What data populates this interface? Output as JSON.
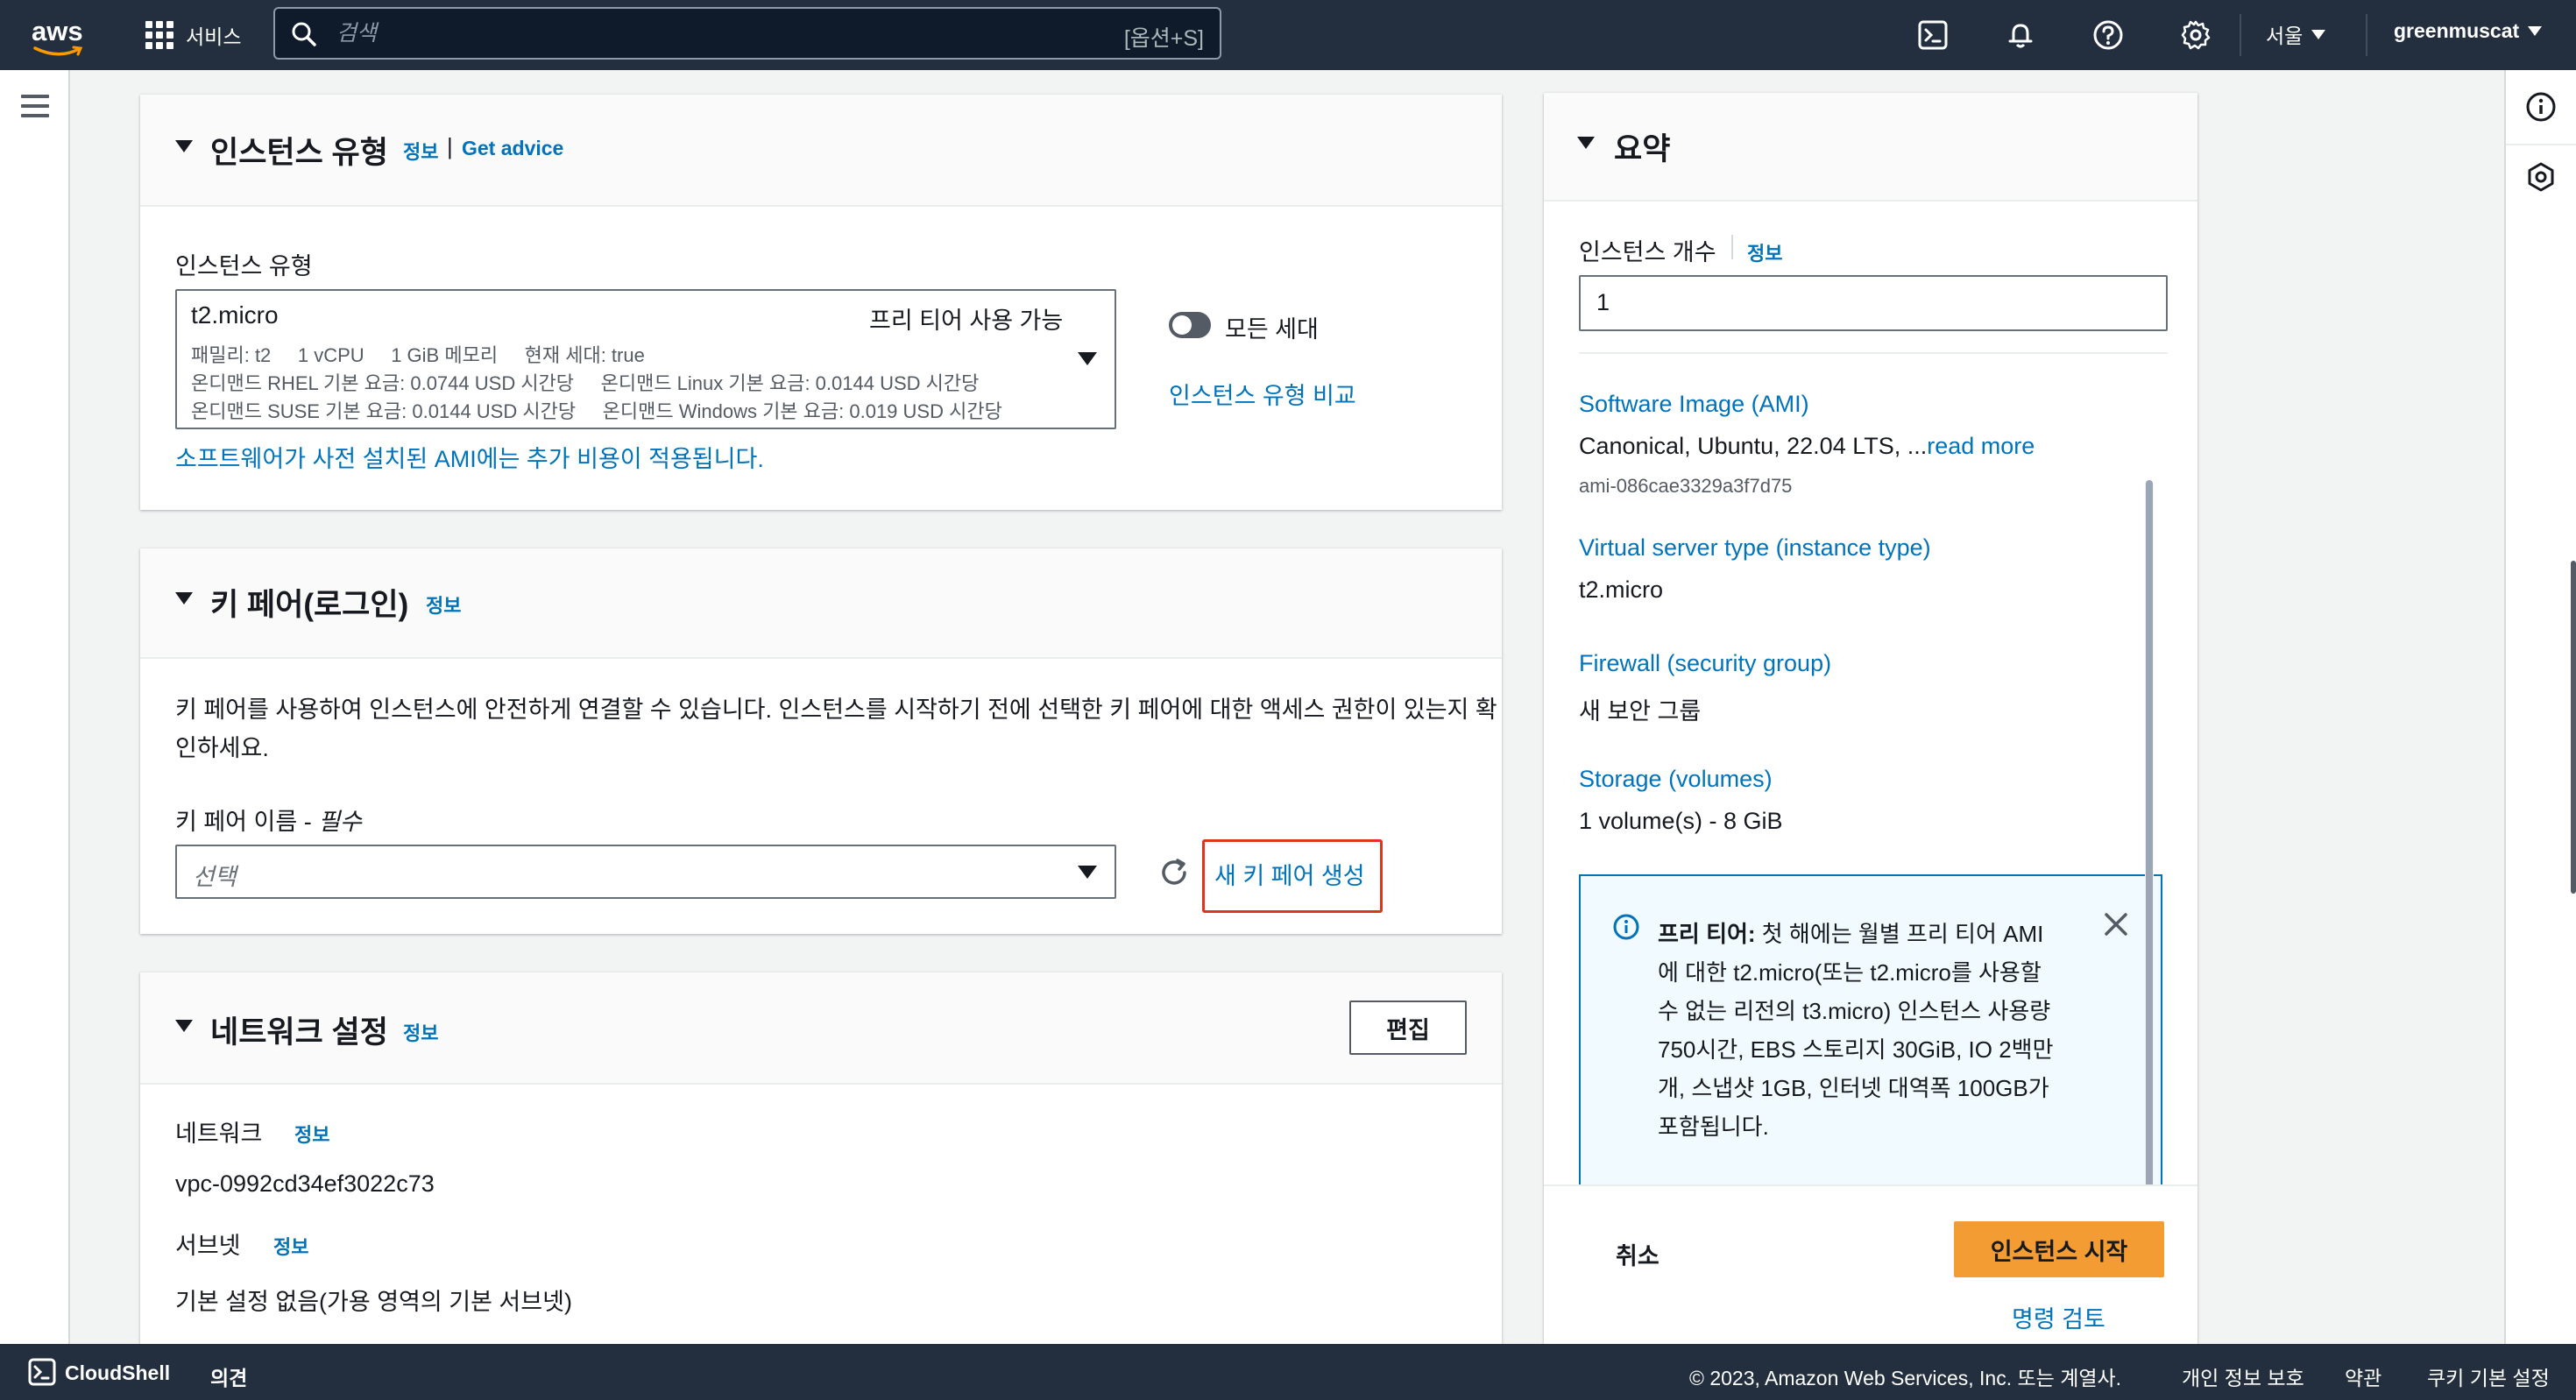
{
  "topnav": {
    "logo_text": "aws",
    "services_label": "서비스",
    "search_placeholder": "검색",
    "search_shortcut": "[옵션+S]",
    "region": "서울",
    "user": "greenmuscat",
    "icons": [
      "cloudshell-icon",
      "bell-icon",
      "help-icon",
      "settings-icon"
    ]
  },
  "instance_type_panel": {
    "title": "인스턴스 유형",
    "info": "정보",
    "separator": "|",
    "advice": "Get advice",
    "field_label": "인스턴스 유형",
    "selected": {
      "name": "t2.micro",
      "free_tier": "프리 티어 사용 가능",
      "line1": "패밀리: t2     1 vCPU     1 GiB 메모리     현재 세대: true",
      "line2": "온디맨드 RHEL 기본 요금: 0.0744 USD 시간당     온디맨드 Linux 기본 요금: 0.0144 USD 시간당",
      "line3": "온디맨드 SUSE 기본 요금: 0.0144 USD 시간당     온디맨드 Windows 기본 요금: 0.019 USD 시간당"
    },
    "toggle_label": "모든 세대",
    "compare_link": "인스턴스 유형 비교",
    "ami_note": "소프트웨어가 사전 설치된 AMI에는 추가 비용이 적용됩니다."
  },
  "keypair_panel": {
    "title": "키 페어(로그인)",
    "info": "정보",
    "description_line1": "키 페어를 사용하여 인스턴스에 안전하게 연결할 수 있습니다. 인스턴스를 시작하기 전에 선택한 키 페어에 대한 액세스 권한이 있는지 확",
    "description_line2": "인하세요.",
    "field_label": "키 페어 이름 - ",
    "required": "필수",
    "select_placeholder": "선택",
    "create_link": "새 키 페어 생성",
    "highlight_color": "#e0341f"
  },
  "network_panel": {
    "title": "네트워크 설정",
    "info": "정보",
    "edit_button": "편집",
    "network_label": "네트워크",
    "network_info": "정보",
    "network_value": "vpc-0992cd34ef3022c73",
    "subnet_label": "서브넷",
    "subnet_info": "정보",
    "subnet_value": "기본 설정 없음(가용 영역의 기본 서브넷)"
  },
  "summary_panel": {
    "title": "요약",
    "count_label": "인스턴스 개수",
    "count_info": "정보",
    "count_value": "1",
    "ami_heading": "Software Image (AMI)",
    "ami_value": "Canonical, Ubuntu, 22.04 LTS, ...",
    "ami_read_more": "read more",
    "ami_id": "ami-086cae3329a3f7d75",
    "type_heading": "Virtual server type (instance type)",
    "type_value": "t2.micro",
    "firewall_heading": "Firewall (security group)",
    "firewall_value": "새 보안 그룹",
    "storage_heading": "Storage (volumes)",
    "storage_value": "1 volume(s) - 8 GiB",
    "free_tier_title": "프리 티어:",
    "free_tier_lines": [
      " 첫 해에는 월별 프리 티어 AMI",
      "에 대한 t2.micro(또는 t2.micro를 사용할",
      "수 없는 리전의 t3.micro) 인스턴스 사용량",
      "750시간, EBS 스토리지 30GiB, IO 2백만",
      "개, 스냅샷 1GB, 인터넷 대역폭 100GB가",
      "포함됩니다."
    ],
    "cancel": "취소",
    "launch": "인스턴스 시작",
    "review": "명령 검토",
    "accent_color": "#ec7211",
    "link_color": "#0073bb"
  },
  "footer": {
    "cloudshell": "CloudShell",
    "feedback": "의견",
    "copyright": "© 2023, Amazon Web Services, Inc. 또는 계열사.",
    "privacy": "개인 정보 보호",
    "terms": "약관",
    "cookies": "쿠키 기본 설정"
  }
}
